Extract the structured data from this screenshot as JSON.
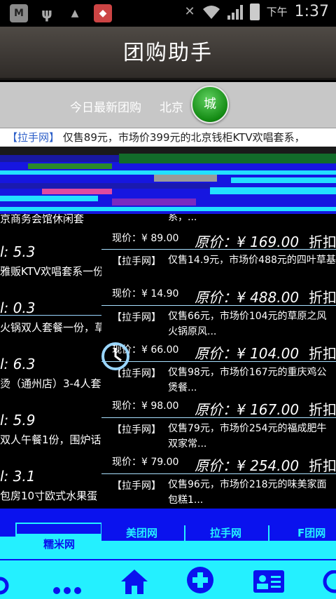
{
  "status_bar": {
    "left_icons": [
      "shield-app-icon",
      "usb-icon",
      "android-debug-icon",
      "app-store-icon"
    ],
    "ampm": "下午",
    "time": "1:37"
  },
  "header": {
    "title": "团购助手"
  },
  "subheader": {
    "today_label": "今日最新团购",
    "city_name": "北京",
    "city_button": "城"
  },
  "ticker": {
    "source": "【拉手网】",
    "text": "仅售89元，市场价399元的北京钱柜KTV欢唱套系，"
  },
  "left_list": [
    {
      "title": "京商务会馆休闲套",
      "score": "l: 5.3"
    },
    {
      "title": "雅贩KTV欢唱套系一份.",
      "score": "l: 0.3"
    },
    {
      "title": "火锅双人套餐一份，草",
      "score": "l: 6.3"
    },
    {
      "title": "烫（通州店）3-4人套",
      "score": "l: 5.9"
    },
    {
      "title": "双人午餐1份，围炉话",
      "score": "l: 3.1"
    },
    {
      "title": "包房10寸欧式水果蛋",
      "score": ""
    }
  ],
  "deals": [
    {
      "source": "",
      "desc": "系，...",
      "now": "现价：¥ 89.00",
      "orig": "原价：¥ 169.00",
      "disc": "折扣"
    },
    {
      "source": "【拉手网】",
      "desc": "仅售14.9元，市场价488元的四叶草基",
      "now": "现价：¥ 14.90",
      "orig": "原价：¥ 488.00",
      "disc": "折扣"
    },
    {
      "source": "【拉手网】",
      "desc": "仅售66元，市场价104元的草原之风火锅原风...",
      "now": "现价：¥ 66.00",
      "orig": "原价：¥ 104.00",
      "disc": "折扣"
    },
    {
      "source": "【拉手网】",
      "desc": "仅售98元，市场价167元的重庆鸡公煲餐...",
      "now": "现价：¥ 98.00",
      "orig": "原价：¥ 167.00",
      "disc": "折扣"
    },
    {
      "source": "【拉手网】",
      "desc": "仅售79元，市场价254元的福成肥牛双家常...",
      "now": "现价：¥ 79.00",
      "orig": "原价：¥ 254.00",
      "disc": "折扣"
    },
    {
      "source": "【拉手网】",
      "desc": "仅售96元，市场价218元的味美家面包糕1...",
      "now": "",
      "orig": "",
      "disc": ""
    }
  ],
  "source_tabs": [
    "糯米网",
    "美团网",
    "拉手网",
    "F团网"
  ],
  "bottom_nav": [
    "search-icon",
    "more-icon",
    "home-icon",
    "add-icon",
    "profile-card-icon",
    "more-partial-icon"
  ],
  "colors": {
    "list_bg": "#0a12ee",
    "tab_bg": "#24f0ff",
    "title_bar": "#3f3a36",
    "city_button": "#1a9a1a"
  }
}
